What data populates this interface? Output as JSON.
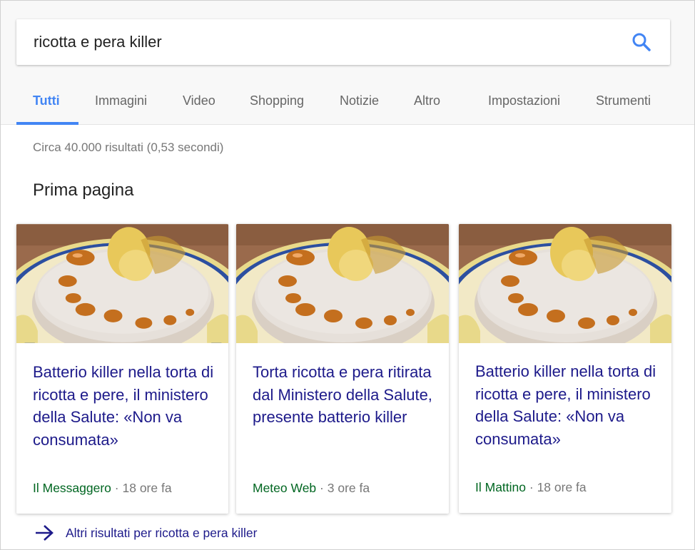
{
  "search": {
    "query": "ricotta e pera killer"
  },
  "tabs": [
    {
      "label": "Tutti"
    },
    {
      "label": "Immagini"
    },
    {
      "label": "Video"
    },
    {
      "label": "Shopping"
    },
    {
      "label": "Notizie"
    },
    {
      "label": "Altro"
    },
    {
      "label": "Impostazioni"
    },
    {
      "label": "Strumenti"
    }
  ],
  "results_stats": "Circa 40.000 risultati (0,53 secondi)",
  "top_stories": {
    "title": "Prima pagina",
    "cards": [
      {
        "title": "Batterio killer nella torta di ricotta e pere, il ministero della Salute: «Non va consumata»",
        "source": "Il Messaggero",
        "time": "18 ore fa"
      },
      {
        "title": "Torta ricotta e pera ritirata dal Ministero della Salute, presente batterio killer",
        "source": "Meteo Web",
        "time": "3 ore fa"
      },
      {
        "title": "Batterio killer nella torta di ricotta e pere, il ministero della Salute: «Non va consumata»",
        "source": "Il Mattino",
        "time": "18 ore fa"
      }
    ],
    "more_link": "Altri risultati per ricotta e pera killer"
  },
  "colors": {
    "accent": "#4285f4",
    "link": "#1d1a8a",
    "source": "#006621"
  }
}
